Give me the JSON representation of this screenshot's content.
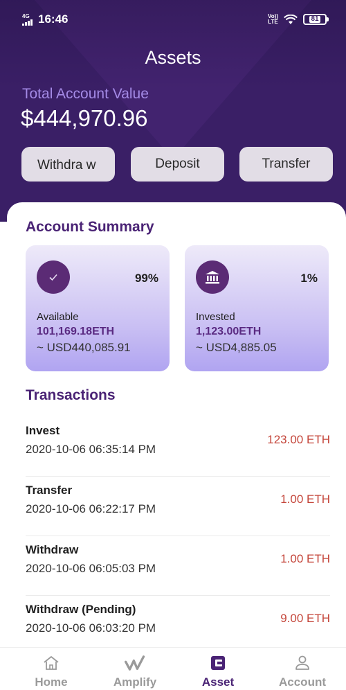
{
  "status_bar": {
    "network": "4G",
    "time": "16:46",
    "volte_line1": "Vo))",
    "volte_line2": "LTE",
    "battery": "81"
  },
  "page": {
    "title": "Assets",
    "total_label": "Total Account Value",
    "total_value": "$444,970.96"
  },
  "actions": {
    "withdraw_label": "Withdra w",
    "deposit_label": "Deposit",
    "transfer_label": "Transfer"
  },
  "summary": {
    "title": "Account Summary",
    "cards": [
      {
        "percent": "99%",
        "label": "Available",
        "amount": "101,169.18ETH",
        "usd": "~ USD440,085.91",
        "icon": "check-icon"
      },
      {
        "percent": "1%",
        "label": "Invested",
        "amount": "1,123.00ETH",
        "usd": "~ USD4,885.05",
        "icon": "bank-icon"
      }
    ]
  },
  "transactions": {
    "title": "Transactions",
    "items": [
      {
        "type": "Invest",
        "date": "2020-10-06 06:35:14 PM",
        "amount": "123.00 ETH"
      },
      {
        "type": "Transfer",
        "date": "2020-10-06 06:22:17 PM",
        "amount": "1.00 ETH"
      },
      {
        "type": "Withdraw",
        "date": "2020-10-06 06:05:03 PM",
        "amount": "1.00 ETH"
      },
      {
        "type": "Withdraw (Pending)",
        "date": "2020-10-06 06:03:20 PM",
        "amount": "9.00 ETH"
      }
    ]
  },
  "nav": {
    "items": [
      {
        "label": "Home",
        "icon": "home-icon"
      },
      {
        "label": "Amplify",
        "icon": "amplify-icon"
      },
      {
        "label": "Asset",
        "icon": "wallet-icon",
        "active": true
      },
      {
        "label": "Account",
        "icon": "user-icon"
      }
    ]
  },
  "colors": {
    "header_bg": "#3a1f66",
    "accent": "#4a2375",
    "amount_red": "#c4453a",
    "label_purple": "#a48ae6"
  }
}
